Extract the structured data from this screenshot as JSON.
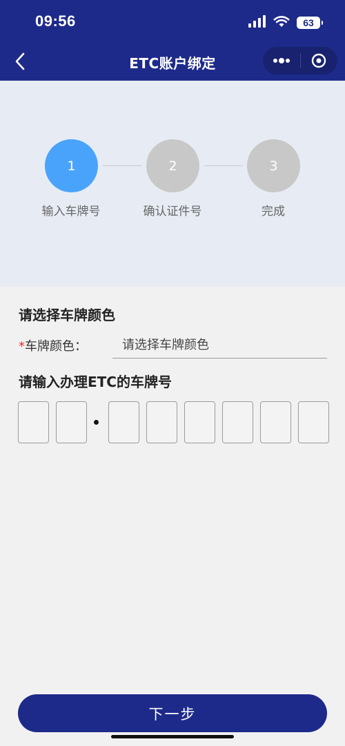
{
  "status_bar": {
    "time": "09:56",
    "battery": "63"
  },
  "nav": {
    "title": "ETC账户绑定"
  },
  "steps": [
    {
      "number": "1",
      "label": "输入车牌号",
      "active": true
    },
    {
      "number": "2",
      "label": "确认证件号",
      "active": false
    },
    {
      "number": "3",
      "label": "完成",
      "active": false
    }
  ],
  "colors": {
    "header": "#1e2a8a",
    "active_step": "#4aa3fa",
    "inactive_step": "#c8c8c8",
    "required": "#e0302b"
  },
  "form": {
    "color_section_title": "请选择车牌颜色",
    "required_mark": "*",
    "color_label": "车牌颜色：",
    "color_placeholder": "请选择车牌颜色",
    "plate_section_title": "请输入办理ETC的车牌号",
    "plate_chars": [
      "",
      "",
      "",
      "",
      "",
      "",
      "",
      ""
    ]
  },
  "footer": {
    "next_label": "下一步"
  }
}
